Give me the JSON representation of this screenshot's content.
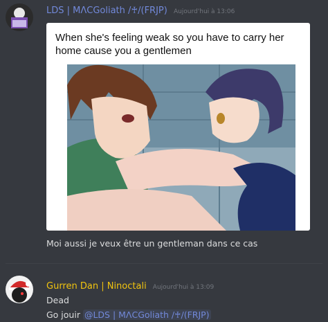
{
  "messages": [
    {
      "username": "LDS | MΛCGoliath /♰/(FRJP)",
      "username_color": "#7289da",
      "timestamp": "Aujourd'hui à 13:06",
      "image": {
        "caption": "When she's feeling weak so you have to carry her home cause you a gentlemen"
      },
      "text": "Moi aussi je veux être un gentleman dans ce cas"
    },
    {
      "username": "Gurren Dan | Ninoctali",
      "username_color": "#f1c40f",
      "timestamp": "Aujourd'hui à 13:09",
      "lines": [
        "Dead",
        "Go jouir"
      ],
      "mention": "@LDS | MΛCGoliath /♰/(FRJP)"
    }
  ]
}
